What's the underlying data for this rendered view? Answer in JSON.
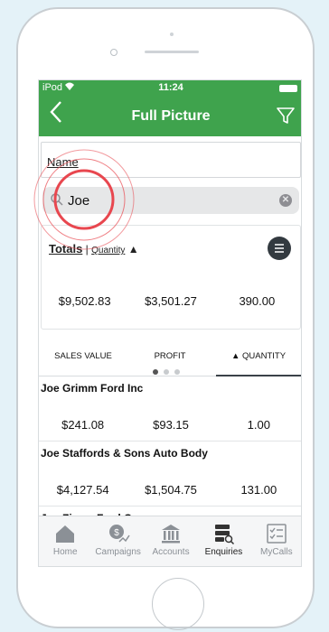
{
  "status_bar": {
    "carrier": "iPod",
    "time": "11:24"
  },
  "nav": {
    "title": "Full Picture",
    "back_icon": "chevron-left-icon",
    "filter_icon": "filter-icon"
  },
  "name_field": {
    "label": "Name"
  },
  "search": {
    "value": "Joe",
    "icon": "search-icon",
    "clear_icon": "clear-icon"
  },
  "totals": {
    "label": "Totals",
    "sort_label": "Quantity",
    "sort_arrow": "▲",
    "values": [
      "$9,502.83",
      "$3,501.27",
      "390.00"
    ]
  },
  "columns": {
    "sales_value": "SALES VALUE",
    "profit": "PROFIT",
    "quantity": "▲ QUANTITY"
  },
  "rows": [
    {
      "name": "Joe Grimm Ford Inc",
      "values": [
        "$241.08",
        "$93.15",
        "1.00"
      ]
    },
    {
      "name": "Joe Staffords & Sons Auto Body",
      "values": [
        "$4,127.54",
        "$1,504.75",
        "131.00"
      ]
    },
    {
      "name": "Joe Ziems Ford Corners",
      "values": [
        "",
        "",
        ""
      ]
    }
  ],
  "tabbar": {
    "items": [
      {
        "label": "Home",
        "icon": "home-icon"
      },
      {
        "label": "Campaigns",
        "icon": "campaigns-icon"
      },
      {
        "label": "Accounts",
        "icon": "bank-icon"
      },
      {
        "label": "Enquiries",
        "icon": "enquiries-icon"
      },
      {
        "label": "MyCalls",
        "icon": "checklist-icon"
      }
    ],
    "active": "Enquiries"
  },
  "colors": {
    "brand_green": "#3fa34d",
    "highlight_ring": "#e8474f"
  }
}
